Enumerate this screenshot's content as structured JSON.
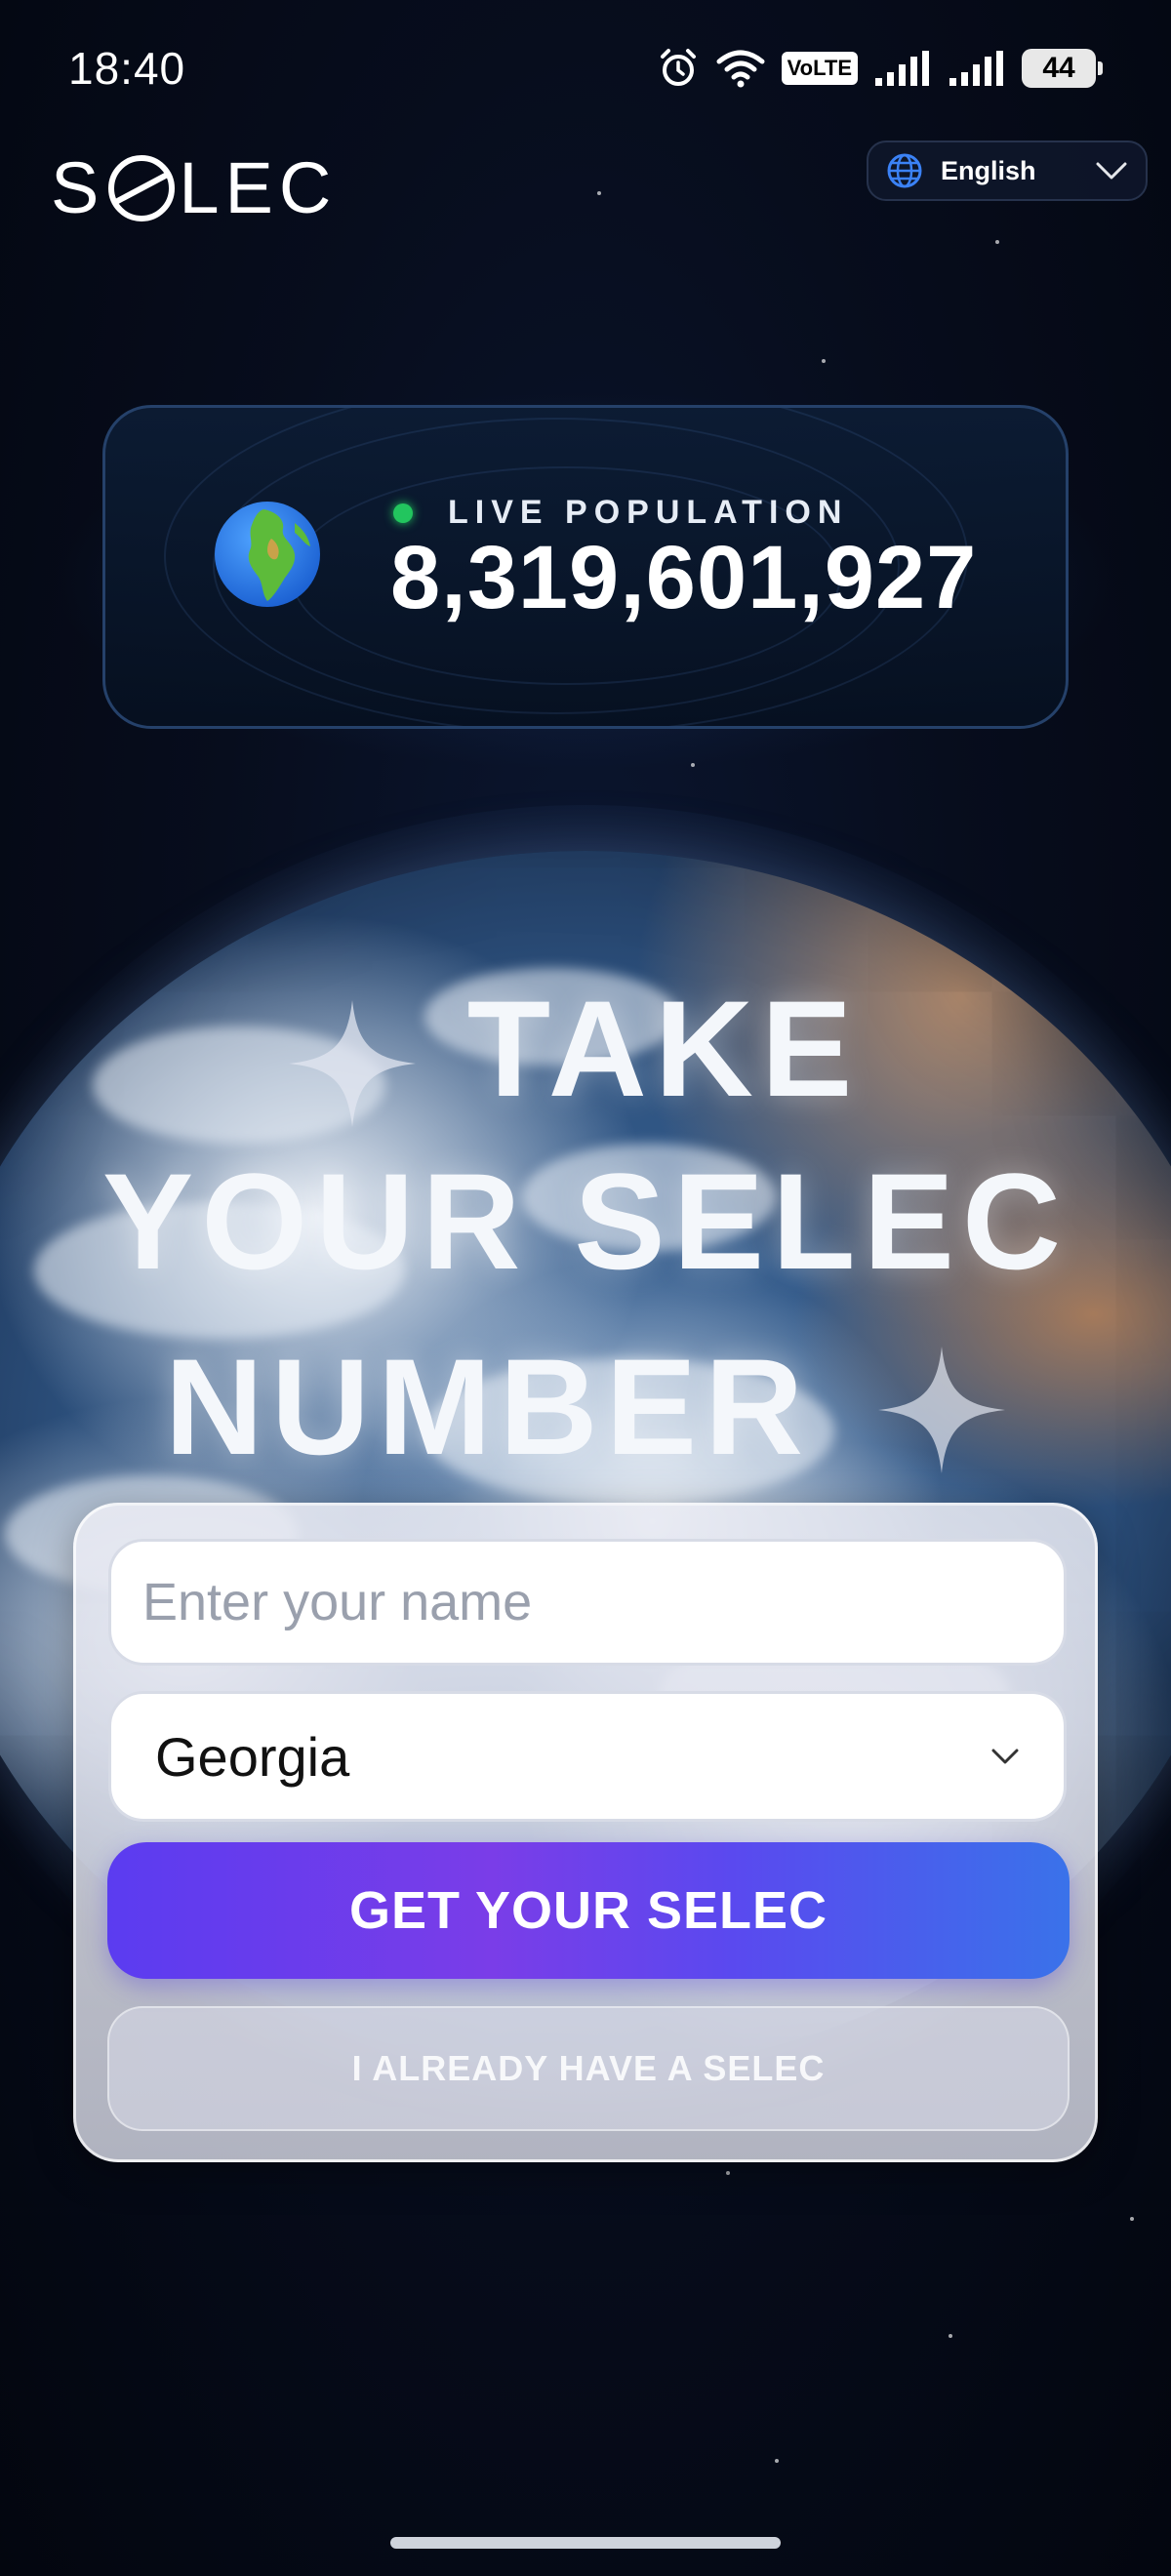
{
  "status_bar": {
    "time": "18:40",
    "network_badge": "VoLTE",
    "battery": "44"
  },
  "header": {
    "logo": "SELEC",
    "language": "English"
  },
  "population": {
    "label": "LIVE POPULATION",
    "count": "8,319,601,927"
  },
  "hero": {
    "line1": "TAKE",
    "line2": "YOUR SELEC",
    "line3": "NUMBER"
  },
  "form": {
    "name_placeholder": "Enter your name",
    "country": "Georgia",
    "primary_button": "GET YOUR SELEC",
    "secondary_button": "I ALREADY HAVE A SELEC"
  },
  "icons": {
    "language": "globe-icon",
    "country_dropdown": "chevron-down-icon",
    "population": "earth-icon"
  },
  "colors": {
    "live_dot": "#22c55e",
    "cta_start": "#5b3cf0",
    "cta_end": "#3a72ea"
  }
}
